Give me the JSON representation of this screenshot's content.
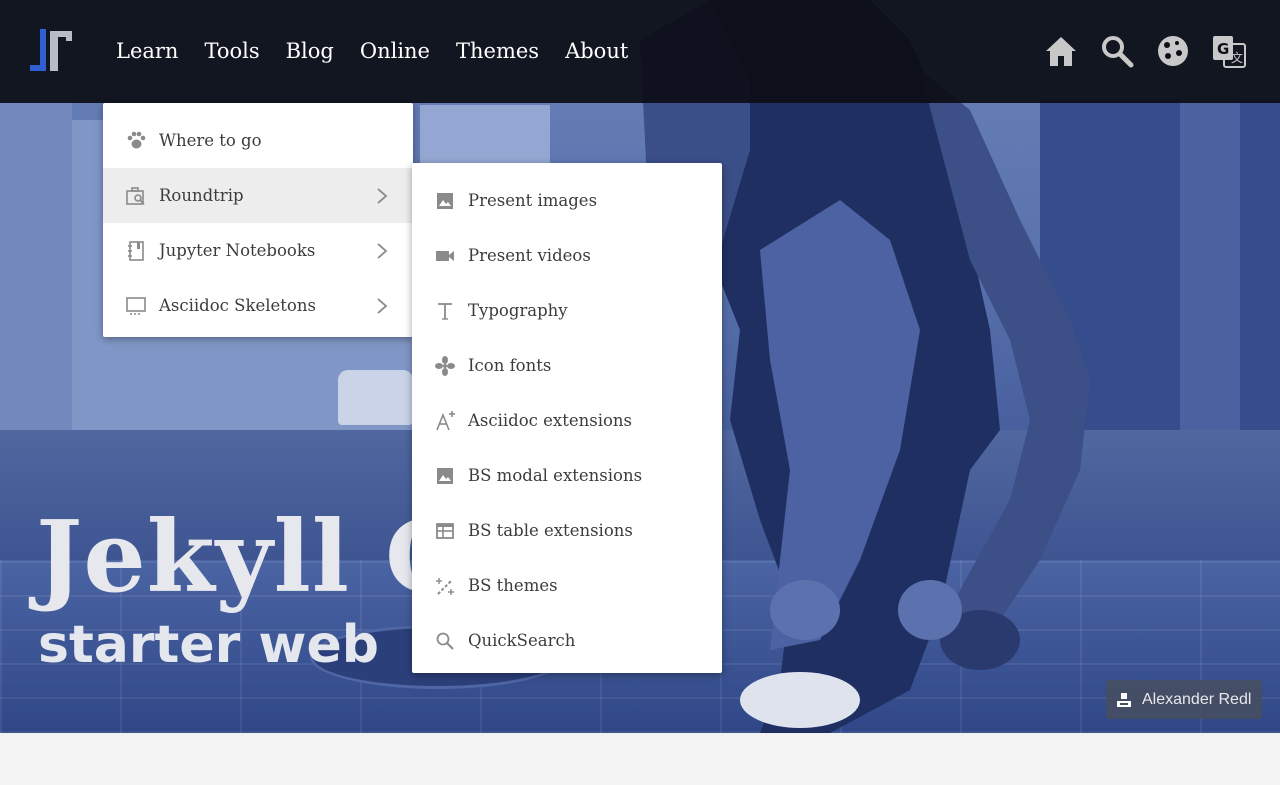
{
  "nav": {
    "links": [
      "Learn",
      "Tools",
      "Blog",
      "Online",
      "Themes",
      "About"
    ],
    "icons": [
      "home-icon",
      "search-icon",
      "cookie-icon",
      "translate-icon"
    ]
  },
  "menu": {
    "items": [
      {
        "label": "Where to go",
        "icon": "paw-icon"
      },
      {
        "label": "Roundtrip",
        "icon": "case-search-icon"
      },
      {
        "label": "Jupyter Notebooks",
        "icon": "notebook-icon"
      },
      {
        "label": "Asciidoc Skeletons",
        "icon": "monitor-icon"
      }
    ],
    "active_item": "Roundtrip"
  },
  "submenu": {
    "items": [
      {
        "label": "Present images",
        "icon": "image-icon"
      },
      {
        "label": "Present videos",
        "icon": "video-icon"
      },
      {
        "label": "Typography",
        "icon": "text-icon"
      },
      {
        "label": "Icon fonts",
        "icon": "fan-icon"
      },
      {
        "label": "Asciidoc extensions",
        "icon": "font-plus-icon"
      },
      {
        "label": "BS modal extensions",
        "icon": "image-icon"
      },
      {
        "label": "BS table extensions",
        "icon": "table-icon"
      },
      {
        "label": "BS themes",
        "icon": "magic-wand-icon"
      },
      {
        "label": "QuickSearch",
        "icon": "search-icon"
      }
    ]
  },
  "hero": {
    "title": "Jekyll C",
    "subtitle": "starter web",
    "credit": "Alexander Redl"
  },
  "colors": {
    "navbar": "#0c0e16",
    "hero_tint": "#4a62a0",
    "menu_icon": "#8a8a8a",
    "brand_blue": "#2f5fd0"
  }
}
